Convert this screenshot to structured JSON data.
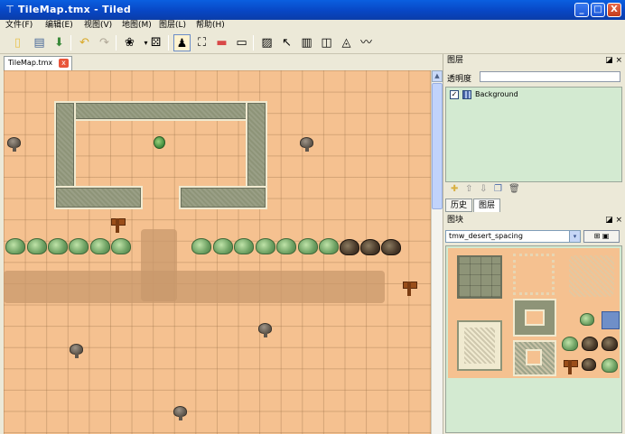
{
  "window": {
    "title": "TileMap.tmx - Tiled",
    "app_icon": "tiled-icon",
    "minimize": "_",
    "maximize": "□",
    "close": "X"
  },
  "menu": [
    {
      "label": "文件(F)"
    },
    {
      "label": "编辑(E)"
    },
    {
      "label": "视图(V)"
    },
    {
      "label": "地图(M)"
    },
    {
      "label": "图层(L)"
    },
    {
      "label": "帮助(H)"
    }
  ],
  "toolbar": {
    "new_icon": "new-file-icon",
    "open_icon": "open-icon",
    "save_icon": "save-icon",
    "undo_icon": "undo-icon",
    "redo_icon": "redo-icon",
    "random_icon": "dice-icon"
  },
  "document": {
    "tab_label": "TileMap.tmx",
    "tab_close": "x"
  },
  "layers_panel": {
    "title": "图层",
    "opacity_label": "透明度",
    "layers": [
      {
        "name": "Background",
        "visible": true
      }
    ]
  },
  "bottom_tabs": [
    {
      "label": "历史"
    },
    {
      "label": "图层"
    }
  ],
  "tileset_panel": {
    "title": "图块",
    "selected_tileset": "tmw_desert_spacing",
    "button_label": "⊞ ▣",
    "dropdown_glyph": "▾"
  },
  "panel_buttons": {
    "float": "◪",
    "close": "×"
  },
  "colors": {
    "sand": "#f5c190",
    "wall": "#8e9478",
    "path": "#c8986c",
    "panel_bg": "#d3ead1"
  }
}
